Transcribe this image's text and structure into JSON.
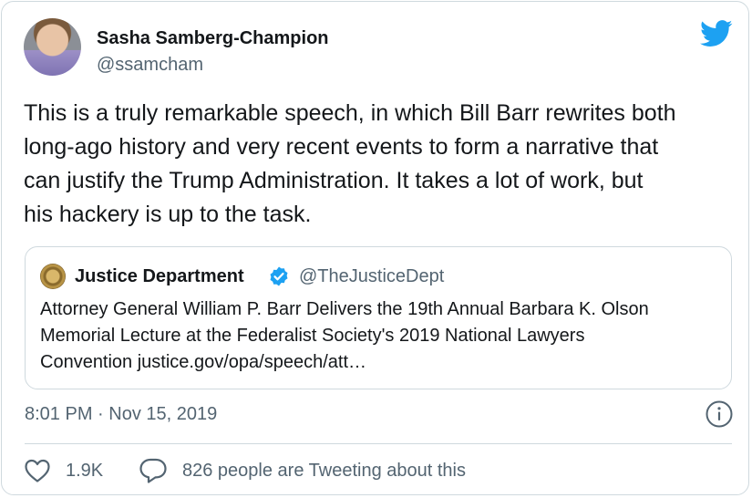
{
  "author": {
    "name": "Sasha Samberg-Champion",
    "handle": "@ssamcham"
  },
  "tweet": {
    "text": "This is a truly remarkable speech, in which Bill Barr rewrites both\nlong-ago history and very recent events to form a narrative that\ncan justify the Trump Administration. It takes a lot of work, but\nhis hackery is up to the task."
  },
  "quoted": {
    "name": "Justice Department",
    "handle": "@TheJusticeDept",
    "text": "Attorney General William P. Barr Delivers the 19th Annual Barbara K. Olson\nMemorial Lecture at the Federalist Society's 2019 National Lawyers\nConvention justice.gov/opa/speech/att…"
  },
  "meta": {
    "timestamp": "8:01 PM · Nov 15, 2019"
  },
  "actions": {
    "likes": "1.9K",
    "tweeting": "826 people are Tweeting about this"
  },
  "icons": {
    "bird": "twitter-bird-icon",
    "verified": "verified-badge-icon",
    "info": "info-icon",
    "heart": "heart-icon",
    "bubble": "reply-bubble-icon"
  },
  "colors": {
    "brand": "#1da1f2",
    "secondary_text": "#536471",
    "border": "#cfd9de"
  }
}
